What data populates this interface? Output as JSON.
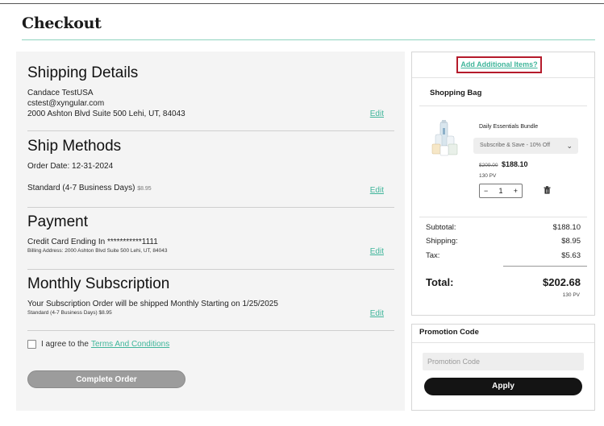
{
  "page": {
    "title": "Checkout"
  },
  "shipping": {
    "title": "Shipping Details",
    "name": "Candace TestUSA",
    "email": "cstest@xyngular.com",
    "address": "2000 Ashton Blvd Suite 500 Lehi, UT, 84043",
    "edit_label": "Edit"
  },
  "ship_methods": {
    "title": "Ship Methods",
    "order_date": "Order Date: 12-31-2024",
    "method": "Standard (4-7 Business Days)",
    "method_price": "$8.95",
    "edit_label": "Edit"
  },
  "payment": {
    "title": "Payment",
    "card": "Credit Card Ending In ***********1111",
    "billing": "Billing Address: 2000 Ashton Blvd Suite 500 Lehi, UT, 84043",
    "edit_label": "Edit"
  },
  "subscription": {
    "title": "Monthly Subscription",
    "text": "Your Subscription Order will be shipped Monthly Starting on 1/25/2025",
    "method": "Standard (4-7 Business Days) $8.95",
    "edit_label": "Edit"
  },
  "agree": {
    "label": "I agree to the",
    "terms_link": "Terms And Conditions",
    "checked": false
  },
  "complete_button": "Complete Order",
  "cart": {
    "add_items_link": "Add Additional Items?",
    "bag_title": "Shopping Bag",
    "item": {
      "name": "Daily Essentials Bundle",
      "option": "Subscribe & Save - 10% Off",
      "old_price": "$209.00",
      "price": "$188.10",
      "pv": "130 PV",
      "quantity": "1",
      "minus": "−",
      "plus": "+"
    },
    "summary": {
      "subtotal_label": "Subtotal:",
      "subtotal": "$188.10",
      "shipping_label": "Shipping:",
      "shipping": "$8.95",
      "tax_label": "Tax:",
      "tax": "$5.63",
      "total_label": "Total:",
      "total": "$202.68",
      "total_pv": "130 PV"
    }
  },
  "promo": {
    "title": "Promotion Code",
    "placeholder": "Promotion Code",
    "apply_label": "Apply"
  },
  "colors": {
    "accent": "#3fb59a",
    "highlight_border": "#b51b2b",
    "disabled_button": "#9c9c9c",
    "apply_button": "#141414"
  },
  "icons": [
    "trash-icon",
    "chevron-down-icon",
    "product-image"
  ]
}
